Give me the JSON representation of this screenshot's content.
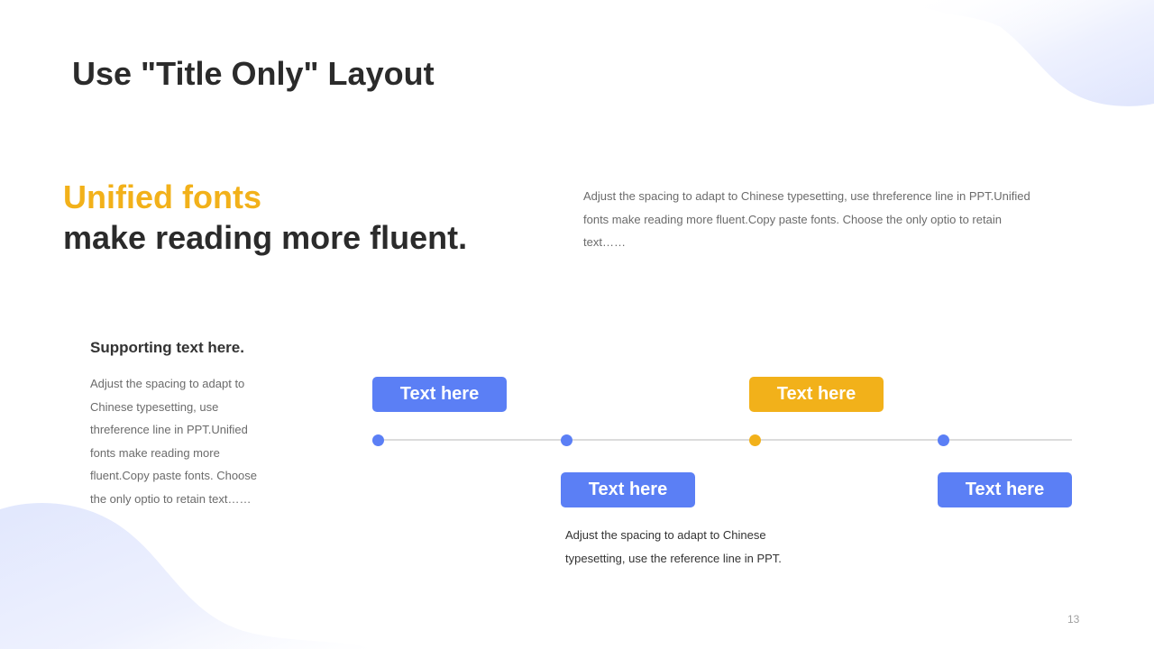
{
  "slide": {
    "title": "Use \"Title Only\" Layout",
    "page_number": "13"
  },
  "headline": {
    "line1": "Unified fonts",
    "line2": "make reading more fluent."
  },
  "intro_paragraph": "Adjust the spacing to adapt to Chinese typesetting, use threference line in PPT.Unified fonts make reading more fluent.Copy paste fonts. Choose the only optio to retain text……",
  "supporting": {
    "heading": "Supporting text here.",
    "paragraph": "Adjust the spacing to adapt to Chinese typesetting, use threference line in PPT.Unified fonts make reading more fluent.Copy paste fonts. Choose the only optio to retain text……"
  },
  "timeline": {
    "labels": [
      "Text here",
      "Text here",
      "Text here",
      "Text here"
    ],
    "caption": "Adjust the spacing to adapt to Chinese typesetting, use the reference line in PPT."
  },
  "colors": {
    "accent_yellow": "#f2b11a",
    "accent_blue": "#5b7ff5",
    "title_text": "#2b2b2b",
    "body_text": "#6b6b6b",
    "line_gray": "#dcdcdc",
    "blob_light": "#e4e9fd"
  }
}
